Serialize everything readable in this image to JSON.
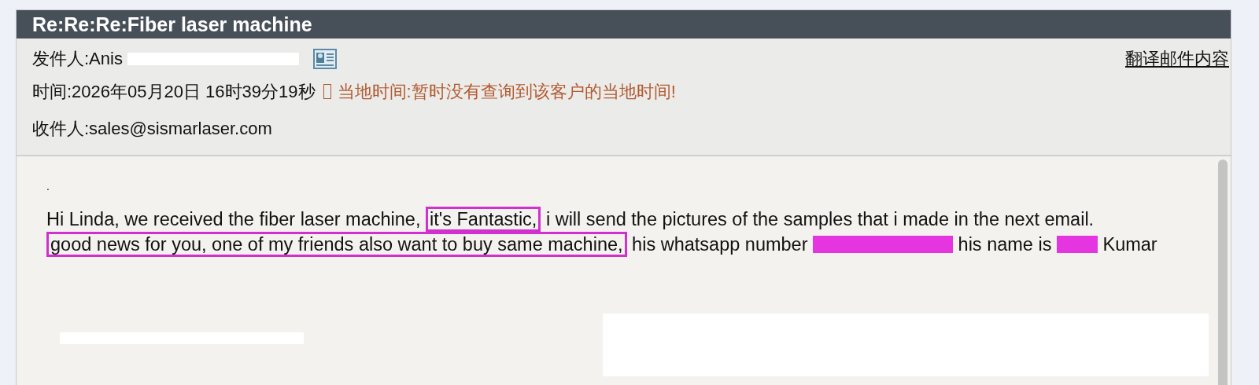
{
  "email": {
    "subject": "Re:Re:Re:Fiber laser machine",
    "sender_label": "发件人:Anis",
    "sender_redaction": {
      "color": "#ffffff"
    },
    "translate_link": "翻译邮件内容",
    "time": "时间:2026年05月20日 16时39分19秒",
    "local_time_note": "当地时间:暂时没有查询到该客户的当地时间!",
    "recipient": "收件人:sales@sismarlaser.com"
  },
  "body": {
    "first_line": ".",
    "paragraphs": [
      [
        {
          "kind": "text",
          "text": "Hi Linda, we received the fiber laser machine, "
        },
        {
          "kind": "highlight",
          "text": "it's Fantastic,"
        },
        {
          "kind": "text",
          "text": " i will send the pictures of the samples that i made in the next email."
        }
      ],
      [
        {
          "kind": "highlight",
          "text": "good news for you, one of my friends also want to buy same machine,"
        },
        {
          "kind": "text",
          "text": " his whatsapp number "
        },
        {
          "kind": "redaction",
          "color": "#e535e0"
        },
        {
          "kind": "text",
          "text": " his name is "
        },
        {
          "kind": "redaction",
          "color": "#e535e0"
        },
        {
          "kind": "text",
          "text": " Kumar"
        }
      ]
    ],
    "trailing_redactions": [
      {
        "color": "#ffffff"
      },
      {
        "color": "#ffffff"
      }
    ]
  }
}
